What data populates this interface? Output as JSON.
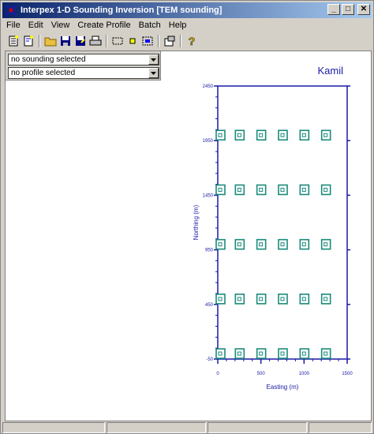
{
  "window": {
    "title": "Interpex 1-D Sounding Inversion [TEM sounding]"
  },
  "menu": [
    "File",
    "Edit",
    "View",
    "Create Profile",
    "Batch",
    "Help"
  ],
  "toolbar": {
    "buttons": [
      "new-sounding-icon",
      "new-model-icon",
      "open-folder-icon",
      "save-icon",
      "save-as-icon",
      "print-icon",
      "select-box-icon",
      "point-icon",
      "zoom-icon",
      "settings-icon",
      "help-icon"
    ]
  },
  "selectors": {
    "sounding": "no sounding selected",
    "profile": "no profile selected"
  },
  "map": {
    "label": "Kamil",
    "xlabel": "Easting (m)",
    "ylabel": "Northing (m)",
    "xticks": [
      "0",
      "500",
      "1000",
      "1500"
    ],
    "yticks": [
      "-50",
      "450",
      "950",
      "1450",
      "1950",
      "2450"
    ],
    "accent": "#1a1aa6",
    "marker_color": "#1a8a7a"
  },
  "chart_data": {
    "type": "scatter",
    "xlabel": "Easting (m)",
    "ylabel": "Northing (m)",
    "xlim": [
      0,
      1500
    ],
    "ylim": [
      -50,
      2450
    ],
    "x": [
      0,
      250,
      500,
      750,
      1000,
      1250
    ],
    "y": [
      0,
      500,
      1000,
      1500,
      2000
    ]
  },
  "status": [
    "",
    "",
    "",
    ""
  ]
}
